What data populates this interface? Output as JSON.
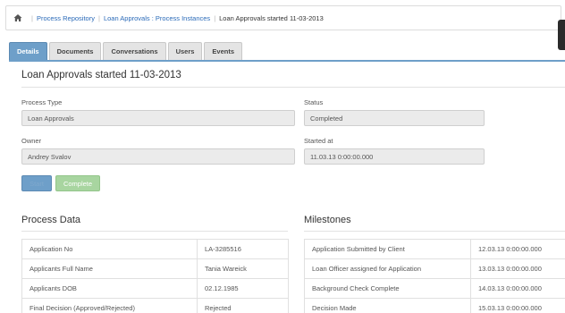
{
  "breadcrumb": {
    "items": [
      "Process Repository",
      "Loan Approvals : Process Instances"
    ],
    "current": "Loan Approvals started 11-03-2013"
  },
  "tabs": [
    {
      "label": "Details",
      "active": true
    },
    {
      "label": "Documents",
      "active": false
    },
    {
      "label": "Conversations",
      "active": false
    },
    {
      "label": "Users",
      "active": false
    },
    {
      "label": "Events",
      "active": false
    }
  ],
  "page_title": "Loan Approvals started 11-03-2013",
  "fields": {
    "process_type": {
      "label": "Process Type",
      "value": "Loan Approvals"
    },
    "status": {
      "label": "Status",
      "value": "Completed"
    },
    "owner": {
      "label": "Owner",
      "value": "Andrey Svalov"
    },
    "started_at": {
      "label": "Started at",
      "value": "11.03.13 0:00:00.000"
    }
  },
  "buttons": {
    "start": "Start",
    "complete": "Complete"
  },
  "process_data": {
    "title": "Process Data",
    "rows": [
      [
        "Application No",
        "LA-3285516"
      ],
      [
        "Applicants Full Name",
        "Tania Wareick"
      ],
      [
        "Applicants DOB",
        "02.12.1985"
      ],
      [
        "Final Decision (Approved/Rejected)",
        "Rejected"
      ]
    ]
  },
  "milestones": {
    "title": "Milestones",
    "rows": [
      [
        "Application Submitted by Client",
        "12.03.13 0:00:00.000"
      ],
      [
        "Loan Officer assigned for Application",
        "13.03.13 0:00:00.000"
      ],
      [
        "Background Check Complete",
        "14.03.13 0:00:00.000"
      ],
      [
        "Decision Made",
        "15.03.13 0:00:00.000"
      ]
    ]
  },
  "colors": {
    "accent": "#6e9fc9",
    "link": "#2a6ab8",
    "success": "#a8d5a0"
  }
}
